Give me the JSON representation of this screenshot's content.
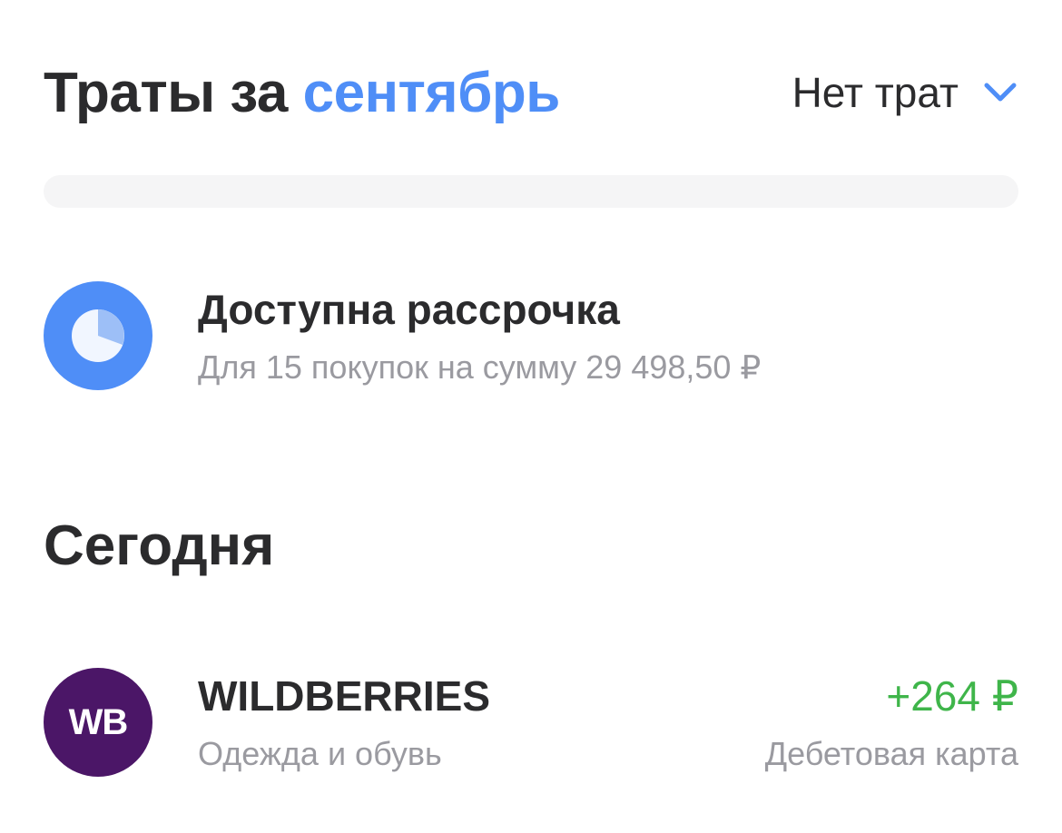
{
  "header": {
    "title_prefix": "Траты за",
    "month": "сентябрь",
    "filter_label": "Нет трат",
    "filter_icon": "chevron-down-icon",
    "accent_color": "#4f8ef7"
  },
  "spending_bar": {
    "fill_fraction": 0
  },
  "installment": {
    "icon": "pie-chart-icon",
    "title": "Доступна рассрочка",
    "subtitle": "Для 15 покупок на сумму 29 498,50 ₽"
  },
  "section": {
    "title": "Сегодня"
  },
  "transactions": [
    {
      "logo_text": "WB",
      "merchant": "WILDBERRIES",
      "category": "Одежда и обувь",
      "amount": "+264 ₽",
      "source": "Дебетовая карта",
      "amount_color": "#3fb54a",
      "logo_color": "#4b1667"
    }
  ]
}
